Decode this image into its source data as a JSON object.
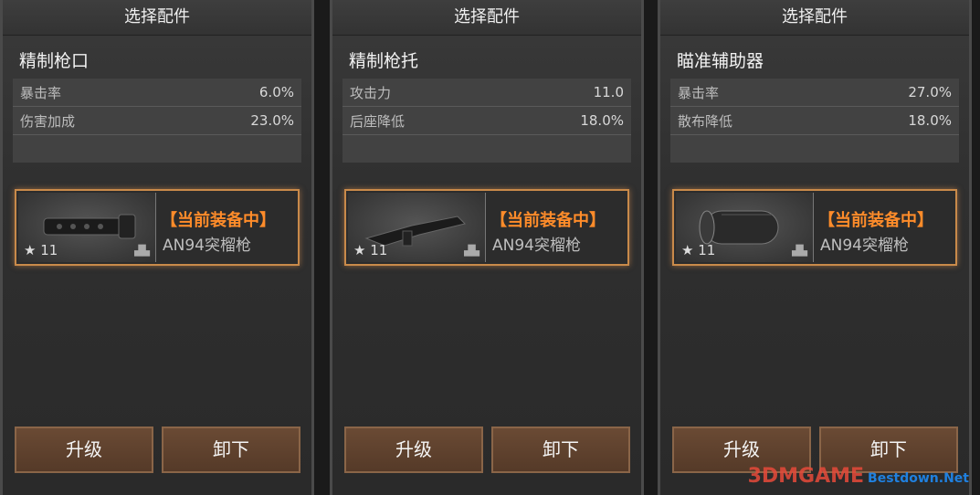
{
  "panels": [
    {
      "title": "选择配件",
      "item_name": "精制枪口",
      "stats": [
        {
          "label": "暴击率",
          "value": "6.0%"
        },
        {
          "label": "伤害加成",
          "value": "23.0%"
        }
      ],
      "equipped": {
        "status": "【当前装备中】",
        "weapon": "AN94突榴枪",
        "level": "11",
        "icon": "muzzle-brake-icon"
      },
      "buttons": {
        "upgrade": "升级",
        "unequip": "卸下"
      }
    },
    {
      "title": "选择配件",
      "item_name": "精制枪托",
      "stats": [
        {
          "label": "攻击力",
          "value": "11.0"
        },
        {
          "label": "后座降低",
          "value": "18.0%"
        }
      ],
      "equipped": {
        "status": "【当前装备中】",
        "weapon": "AN94突榴枪",
        "level": "11",
        "icon": "rifle-stock-icon"
      },
      "buttons": {
        "upgrade": "升级",
        "unequip": "卸下"
      }
    },
    {
      "title": "选择配件",
      "item_name": "瞄准辅助器",
      "stats": [
        {
          "label": "暴击率",
          "value": "27.0%"
        },
        {
          "label": "散布降低",
          "value": "18.0%"
        }
      ],
      "equipped": {
        "status": "【当前装备中】",
        "weapon": "AN94突榴枪",
        "level": "11",
        "icon": "aim-assist-icon"
      },
      "buttons": {
        "upgrade": "升级",
        "unequip": "卸下"
      }
    }
  ],
  "watermark": {
    "text": "3DMGAME",
    "sub": "Bestdown.Net"
  },
  "colors": {
    "accent_orange": "#ff8c2a",
    "button_brown": "#5f4230",
    "card_border": "#c98a4a"
  }
}
